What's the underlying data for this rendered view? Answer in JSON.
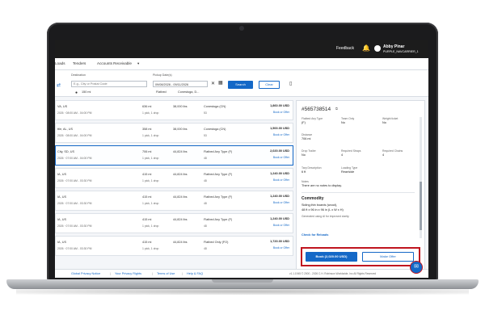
{
  "header": {
    "feedback": "Feedback",
    "user_name": "Abby Pinar",
    "user_code": "PURPLE_NAVCARRIER_1"
  },
  "nav": {
    "items": [
      "Loads",
      "Tenders",
      "Accounts Receivable"
    ]
  },
  "filter": {
    "destination_label": "Destination",
    "destination_placeholder": "E.g., City or Postal Code",
    "pickup_label": "Pickup Date(s)",
    "pickup_value": "09/08/2026 - 09/11/2026",
    "search": "Search",
    "clear": "Clear",
    "radius": "150 mi",
    "equipment": "Flatbed",
    "equipment_sub": "Conestoga, D..."
  },
  "loads": [
    {
      "origin": "VA, US",
      "window": "2026 · 08:00 AM - 04:00 PM",
      "miles": "636 mi",
      "stops": "1 pick, 1 drop",
      "weight": "38,000 lbs",
      "equip": "Conestoga (CN)",
      "length": "53",
      "price": "1,860.00 USD",
      "action": "Book or Offer"
    },
    {
      "origin": "ttle, AL, US",
      "window": "2026 · 08:00 AM - 04:00 PM",
      "miles": "358 mi",
      "stops": "1 pick, 1 drop",
      "weight": "38,000 lbs",
      "equip": "Conestoga (CN)",
      "length": "53",
      "price": "1,500.00 USD",
      "action": "Book or Offer"
    },
    {
      "origin": "City, SD, US",
      "window": "2026 · 07:00 AM - 04:00 PM",
      "miles": "706 mi",
      "stops": "1 pick, 1 drop",
      "weight": "44,824 lbs",
      "equip": "Flatbed Any Type (F)",
      "length": "48",
      "price": "2,020.00 USD",
      "action": "Book or Offer"
    },
    {
      "origin": "IA, US",
      "window": "2026 · 07:00 AM - 03:30 PM",
      "miles": "415 mi",
      "stops": "1 pick, 1 drop",
      "weight": "44,824 lbs",
      "equip": "Flatbed Any Type (F)",
      "length": "48",
      "price": "1,240.00 USD",
      "action": "Book or Offer"
    },
    {
      "origin": "IA, US",
      "window": "2026 · 07:00 AM - 03:30 PM",
      "miles": "415 mi",
      "stops": "1 pick, 1 drop",
      "weight": "44,824 lbs",
      "equip": "Flatbed Any Type (F)",
      "length": "48",
      "price": "1,240.00 USD",
      "action": "Book or Offer"
    },
    {
      "origin": "IA, US",
      "window": "2026 · 07:00 AM - 03:30 PM",
      "miles": "415 mi",
      "stops": "1 pick, 1 drop",
      "weight": "44,824 lbs",
      "equip": "Flatbed Any Type (F)",
      "length": "48",
      "price": "1,240.00 USD",
      "action": "Book or Offer"
    },
    {
      "origin": "IA, US",
      "window": "2026 · 07:00 AM - 03:30 PM",
      "miles": "415 mi",
      "stops": "1 pick, 1 drop",
      "weight": "44,824 lbs",
      "equip": "Flatbed Only (FO)",
      "length": "48",
      "price": "1,720.00 USD",
      "action": "Book or Offer"
    }
  ],
  "detail": {
    "load_id": "#565738514",
    "equip_label": "Flatbed Any Type",
    "equip_val": "(F)",
    "team_label": "Team Only",
    "team_val": "No",
    "weight_label": "Weight ticket",
    "weight_val": "No",
    "distance_label": "Distance",
    "distance_val": "706 mi",
    "drop_label": "Drop Trailer",
    "drop_val": "No",
    "straps_label": "Required Straps",
    "straps_val": "4",
    "chains_label": "Required Chains",
    "chains_val": "4",
    "tarp_label": "Tarp Description",
    "tarp_val": "6 ft",
    "loading_label": "Loading Type",
    "loading_val": "Rear/side",
    "notes_label": "Notes",
    "notes_val": "There are no notes to display.",
    "commodity_title": "Commodity",
    "commodity_name": "Siding,thin boards (wood),",
    "commodity_dims": "48 ft x 96 in x 96 in (L x W x H)",
    "commodity_note": "Generated using AI for improved clarity.",
    "reloads": "Check for Reloads",
    "book_label": "Book (2,020.00 USD)",
    "offer_label": "Make Offer"
  },
  "footer": {
    "links": [
      "Global Privacy Notice",
      "Your Privacy Rights",
      "Terms of Use",
      "Help & FAQ"
    ],
    "copyright": "v1.1.1945 © 2000 - 2026 C.H. Robinson Worldwide, Inc All Rights Reserved"
  },
  "colors": {
    "accent": "#1468c7",
    "highlight": "#c0151f",
    "topbar": "#1c1c1c"
  }
}
